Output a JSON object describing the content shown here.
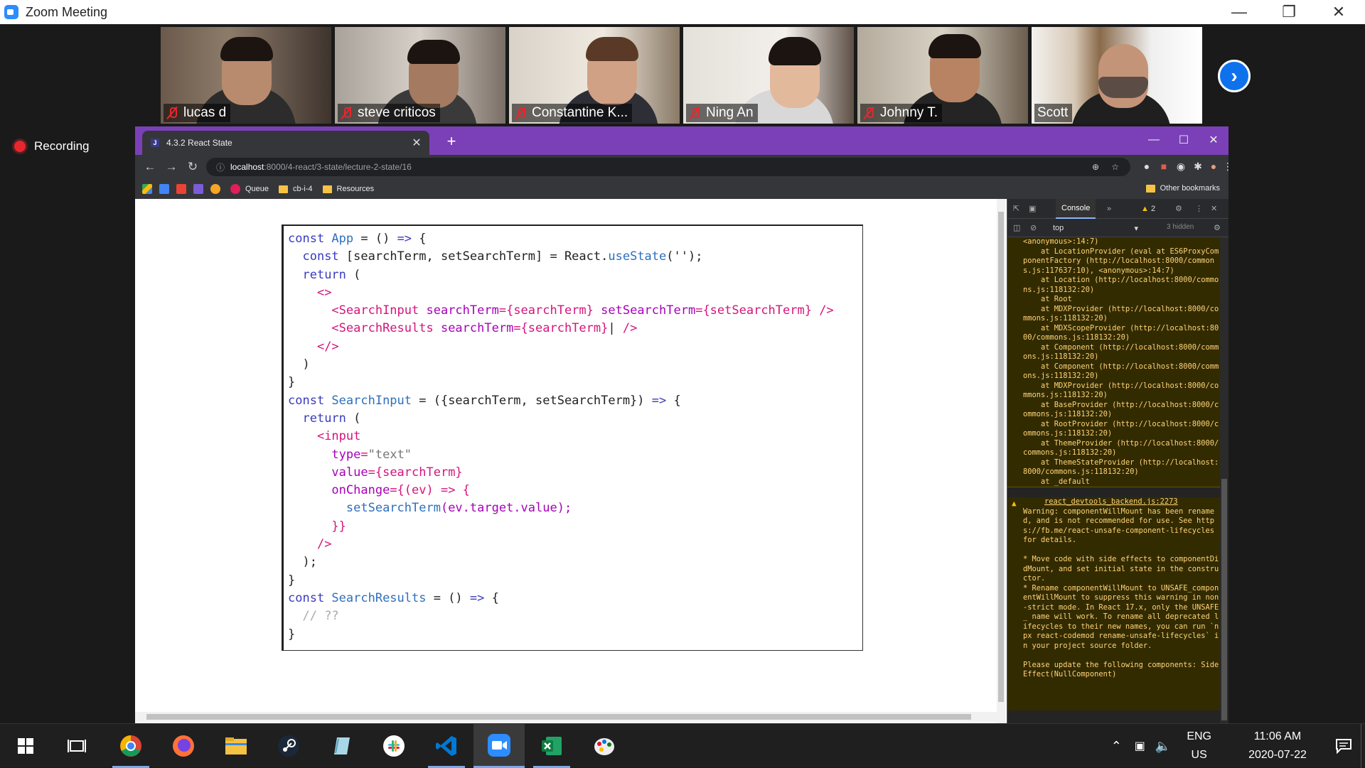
{
  "zoom": {
    "title": "Zoom Meeting",
    "recording_label": "Recording",
    "participants": [
      {
        "name": "lucas d",
        "muted": true
      },
      {
        "name": "steve criticos",
        "muted": true
      },
      {
        "name": "Constantine K...",
        "muted": true
      },
      {
        "name": "Ning An",
        "muted": true
      },
      {
        "name": "Johnny T.",
        "muted": true
      },
      {
        "name": "Scott",
        "muted": false,
        "active_speaker": true
      }
    ]
  },
  "browser": {
    "tab_title": "4.3.2 React State",
    "tab_favicon": "J",
    "url_host": "localhost",
    "url_path": ":8000/4-react/3-state/lecture-2-state/16",
    "bookmarks": [
      "Queue",
      "cb-i-4",
      "Resources"
    ],
    "other_bookmarks": "Other bookmarks"
  },
  "code": [
    [
      [
        "kw",
        "const "
      ],
      [
        "fn",
        "App"
      ],
      [
        "pu",
        " = () "
      ],
      [
        "kw",
        "=>"
      ],
      [
        "pu",
        " {"
      ]
    ],
    [
      [
        "pu",
        "  "
      ],
      [
        "kw",
        "const "
      ],
      [
        "pu",
        "[searchTerm, setSearchTerm] = React."
      ],
      [
        "fn",
        "useState"
      ],
      [
        "pu",
        "('');"
      ]
    ],
    [
      [
        "pu",
        "  "
      ],
      [
        "kw",
        "return"
      ],
      [
        "pu",
        " ("
      ]
    ],
    [
      [
        "pu",
        "    "
      ],
      [
        "tag",
        "<>"
      ]
    ],
    [
      [
        "pu",
        "      "
      ],
      [
        "tag",
        "<SearchInput "
      ],
      [
        "jsx",
        "searchTerm"
      ],
      [
        "tag",
        "={searchTerm} "
      ],
      [
        "jsx",
        "setSearchTerm"
      ],
      [
        "tag",
        "={setSearchTerm} />"
      ]
    ],
    [
      [
        "pu",
        "      "
      ],
      [
        "tag",
        "<SearchResults "
      ],
      [
        "jsx",
        "searchTerm"
      ],
      [
        "tag",
        "={searchTerm}"
      ],
      [
        "pu",
        "| "
      ],
      [
        "tag",
        "/>"
      ]
    ],
    [
      [
        "pu",
        "    "
      ],
      [
        "tag",
        "</>"
      ]
    ],
    [
      [
        "pu",
        "  )"
      ]
    ],
    [
      [
        "pu",
        "}"
      ]
    ],
    [
      [
        "kw",
        "const "
      ],
      [
        "fn",
        "SearchInput"
      ],
      [
        "pu",
        " = ({searchTerm, setSearchTerm}) "
      ],
      [
        "kw",
        "=>"
      ],
      [
        "pu",
        " {"
      ]
    ],
    [
      [
        "pu",
        "  "
      ],
      [
        "kw",
        "return"
      ],
      [
        "pu",
        " ("
      ]
    ],
    [
      [
        "pu",
        "    "
      ],
      [
        "tag",
        "<input"
      ]
    ],
    [
      [
        "pu",
        "      "
      ],
      [
        "jsx",
        "type"
      ],
      [
        "tag",
        "="
      ],
      [
        "str",
        "\"text\""
      ]
    ],
    [
      [
        "pu",
        "      "
      ],
      [
        "jsx",
        "value"
      ],
      [
        "tag",
        "={searchTerm}"
      ]
    ],
    [
      [
        "pu",
        "      "
      ],
      [
        "jsx",
        "onChange"
      ],
      [
        "tag",
        "={(ev) => {"
      ]
    ],
    [
      [
        "pu",
        "        "
      ],
      [
        "fn",
        "setSearchTerm"
      ],
      [
        "jsx",
        "(ev.target.value);"
      ]
    ],
    [
      [
        "pu",
        "      "
      ],
      [
        "tag",
        "}}"
      ]
    ],
    [
      [
        "pu",
        "    "
      ],
      [
        "tag",
        "/>"
      ]
    ],
    [
      [
        "pu",
        "  );"
      ]
    ],
    [
      [
        "pu",
        "}"
      ]
    ],
    [
      [
        "kw",
        "const "
      ],
      [
        "fn",
        "SearchResults"
      ],
      [
        "pu",
        " = () "
      ],
      [
        "kw",
        "=>"
      ],
      [
        "pu",
        " {"
      ]
    ],
    [
      [
        "pu",
        "  "
      ],
      [
        "cmt",
        "// ??"
      ]
    ],
    [
      [
        "pu",
        "}"
      ]
    ]
  ],
  "devtools": {
    "console_tab": "Console",
    "warning_count": "2",
    "context": "top",
    "hidden": "3 hidden",
    "stack": [
      "<anonymous>:14:7)",
      "    at LocationProvider (eval at ES6ProxyComponentFactory (http://localhost:8000/commons.js:117637:10), <anonymous>:14:7)",
      "    at Location (http://localhost:8000/commons.js:118132:20)",
      "    at Root",
      "    at MDXProvider (http://localhost:8000/commons.js:118132:20)",
      "    at MDXScopeProvider (http://localhost:8000/commons.js:118132:20)",
      "    at Component (http://localhost:8000/commons.js:118132:20)",
      "    at Component (http://localhost:8000/commons.js:118132:20)",
      "    at MDXProvider (http://localhost:8000/commons.js:118132:20)",
      "    at BaseProvider (http://localhost:8000/commons.js:118132:20)",
      "    at RootProvider (http://localhost:8000/commons.js:118132:20)",
      "    at ThemeProvider (http://localhost:8000/commons.js:118132:20)",
      "    at ThemeStateProvider (http://localhost:8000/commons.js:118132:20)",
      "    at _default"
    ],
    "warning_source": "react_devtools_backend.js:2273",
    "warning_lines": [
      "Warning: componentWillMount has been renamed, and is not recommended for use. See https://fb.me/react-unsafe-component-lifecycles for details.",
      "",
      "* Move code with side effects to componentDidMount, and set initial state in the constructor.",
      "* Rename componentWillMount to UNSAFE_componentWillMount to suppress this warning in non-strict mode. In React 17.x, only the UNSAFE_ name will work. To rename all deprecated lifecycles to their new names, you can run `npx react-codemod rename-unsafe-lifecycles` in your project source folder.",
      "",
      "Please update the following components: SideEffect(NullComponent)"
    ]
  },
  "taskbar": {
    "lang_top": "ENG",
    "lang_bottom": "US",
    "time": "11:06 AM",
    "date": "2020-07-22"
  }
}
